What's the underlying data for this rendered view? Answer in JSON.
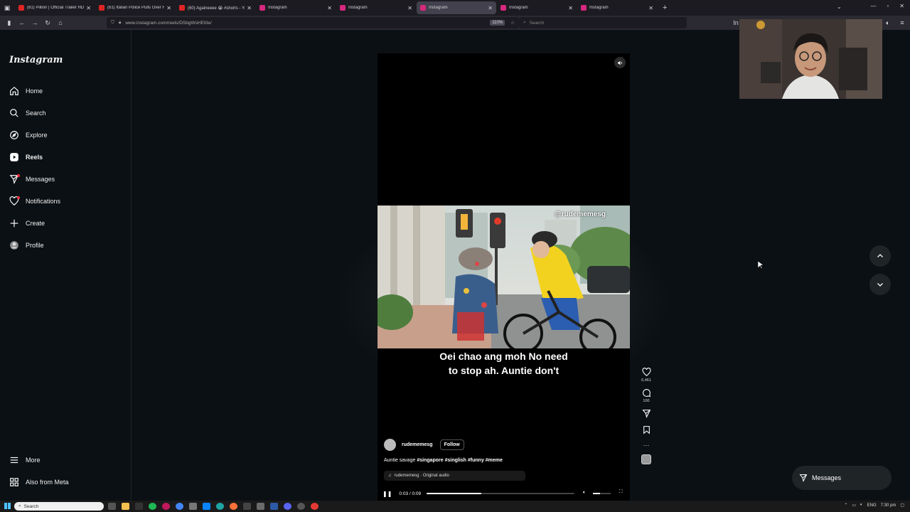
{
  "browser": {
    "tabs": [
      {
        "title": "(61) Pillion | Official Trailer HD |",
        "favicon_color": "#e02424",
        "active": false
      },
      {
        "title": "(61) Italian Police Pulls Over Fe",
        "favicon_color": "#e02424",
        "active": false
      },
      {
        "title": "(60) Againeeee 😭 #shorts - Yo",
        "favicon_color": "#e02424",
        "active": false
      },
      {
        "title": "Instagram",
        "favicon_color": "#d6287c",
        "active": false
      },
      {
        "title": "Instagram",
        "favicon_color": "#d6287c",
        "active": false
      },
      {
        "title": "Instagram",
        "favicon_color": "#d6287c",
        "active": true
      },
      {
        "title": "Instagram",
        "favicon_color": "#d6287c",
        "active": false
      },
      {
        "title": "Instagram",
        "favicon_color": "#d6287c",
        "active": false
      }
    ],
    "url": "www.instagram.com/reels/DSbgWsHEt0e/",
    "zoom": "110%",
    "search_placeholder": "Search"
  },
  "sidebar": {
    "logo": "Instagram",
    "items": [
      {
        "label": "Home",
        "icon": "home-icon",
        "bold": false
      },
      {
        "label": "Search",
        "icon": "search-icon",
        "bold": false
      },
      {
        "label": "Explore",
        "icon": "compass-icon",
        "bold": false
      },
      {
        "label": "Reels",
        "icon": "reels-icon",
        "bold": true
      },
      {
        "label": "Messages",
        "icon": "send-icon",
        "bold": false
      },
      {
        "label": "Notifications",
        "icon": "heart-icon",
        "bold": false
      },
      {
        "label": "Create",
        "icon": "plus-icon",
        "bold": false
      },
      {
        "label": "Profile",
        "icon": "avatar-icon",
        "bold": false
      }
    ],
    "more": "More",
    "also_from_meta": "Also from Meta"
  },
  "reel": {
    "watermark": "@rudememesg",
    "caption_line1": "Oei chao ang moh No need",
    "caption_line2": "to stop ah. Auntie don't",
    "username": "rudememesg",
    "follow_label": "Follow",
    "description_text": "Auntie savage",
    "hashtags": "#singapore #singlish #funny #meme",
    "audio": "rudememesg · Original audio",
    "time": "0:03 / 0:09",
    "progress": 0.37,
    "volume": 0.4
  },
  "actions": {
    "likes": "6,461",
    "comments": "100"
  },
  "messages_button": "Messages",
  "taskbar": {
    "search_placeholder": "Search",
    "lang": "ENG",
    "time": "7:30 pm"
  },
  "colors": {
    "page_bg": "#0b1014",
    "accent_pink": "#d6287c",
    "youtube_red": "#e02424"
  }
}
